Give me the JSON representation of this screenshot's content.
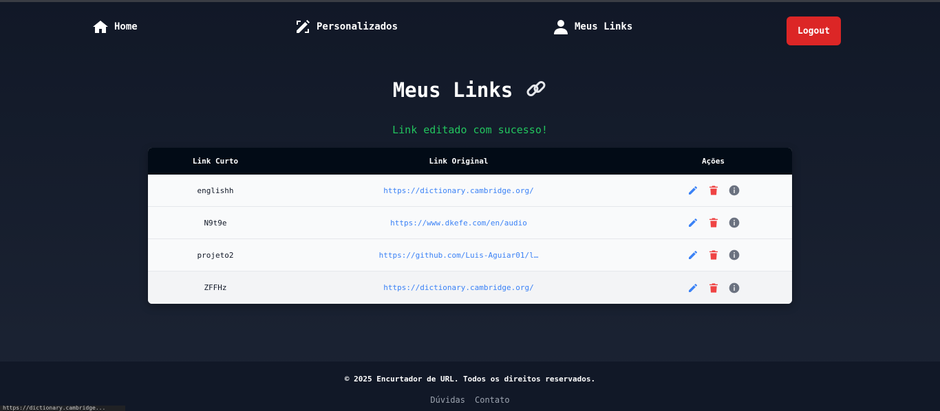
{
  "nav": {
    "home": "Home",
    "custom": "Personalizados",
    "my_links": "Meus Links",
    "logout": "Logout"
  },
  "page": {
    "title": "Meus Links",
    "success_message": "Link editado com sucesso!"
  },
  "table": {
    "headers": [
      "Link Curto",
      "Link Original",
      "Ações"
    ],
    "rows": [
      {
        "short": "englishh",
        "original": "https://dictionary.cambridge.org/"
      },
      {
        "short": "N9t9e",
        "original": "https://www.dkefe.com/en/audio"
      },
      {
        "short": "projeto2",
        "original": "https://github.com/Luis-Aguiar01/l…"
      },
      {
        "short": "ZFFHz",
        "original": "https://dictionary.cambridge.org/"
      }
    ]
  },
  "footer": {
    "copyright": "© 2025 Encurtador de URL. Todos os direitos reservados.",
    "links": [
      "Dúvidas",
      "Contato"
    ]
  },
  "status_bar": "https://dictionary.cambridge...",
  "colors": {
    "logout": "#dc2626",
    "success": "#22c55e",
    "edit_icon": "#3b82f6",
    "delete_icon": "#ef4444",
    "info_icon": "#6b7280"
  }
}
